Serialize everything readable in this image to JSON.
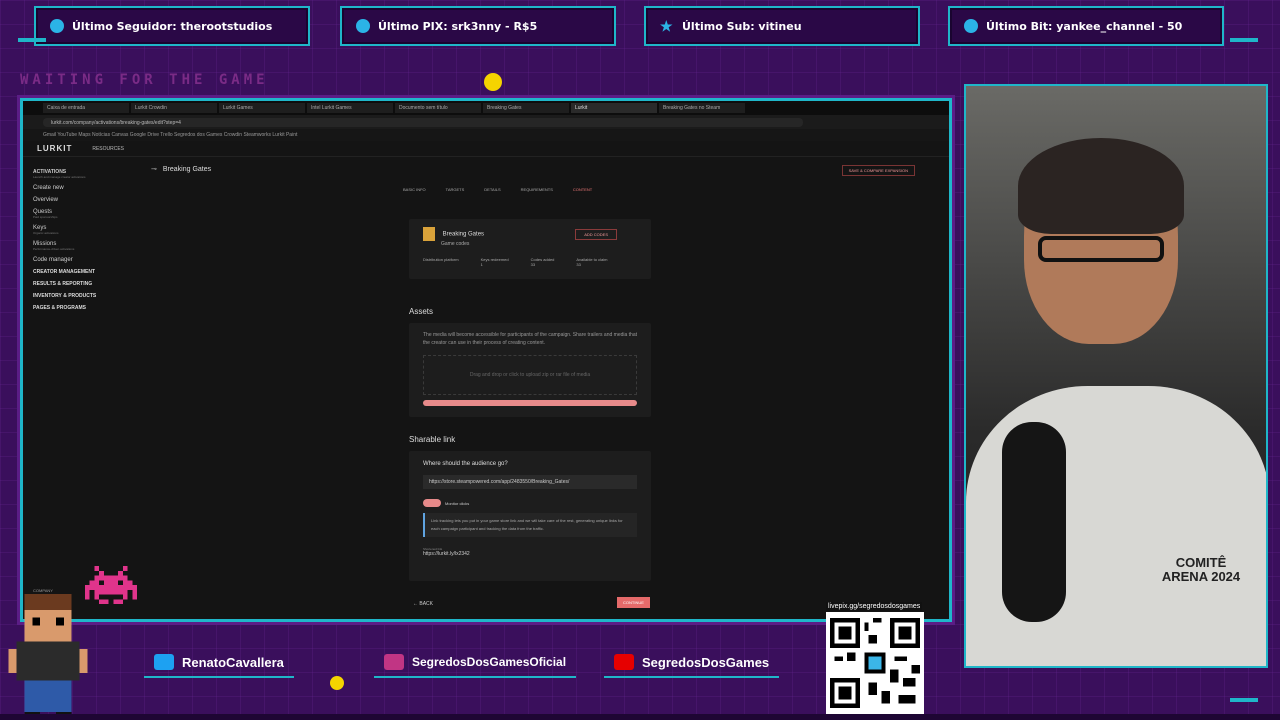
{
  "tickers": [
    {
      "label": "Último Seguidor: therootstudios",
      "icon": "person-icon"
    },
    {
      "label": "Último PIX: srk3nny - R$5",
      "icon": "dollar-icon"
    },
    {
      "label": "Último Sub: vitineu",
      "icon": "star-icon"
    },
    {
      "label": "Último Bit: yankee_channel - 50",
      "icon": "heart-icon"
    }
  ],
  "overlay_title": "WAITING FOR THE GAME",
  "browser": {
    "tabs": [
      "Caixa de entrada",
      "Lurkit Crowdin",
      "Lurkit Games",
      "Intel Lurkit Games",
      "Documento sem título",
      "Breaking Gates",
      "Lurkit",
      "Breaking Gates no Steam"
    ],
    "url": "lurkit.com/company/activations/breaking-gates/edit?step=4",
    "bookmarks": "Gmail  YouTube  Maps  Notícias  Canvas  Google Drive  Trello  Segredos dos Games  Crowdin  Steamworks  Lurkit  Paint"
  },
  "app": {
    "logo": "LURKIT",
    "resources": "RESOURCES",
    "sidebar": {
      "activations_label": "ACTIVATIONS",
      "activations_sub": "Launch and manage creator activations",
      "items": [
        {
          "label": "Create new"
        },
        {
          "label": "Overview"
        },
        {
          "label": "Quests",
          "sub": "Paid sponsorships"
        },
        {
          "label": "Keys",
          "sub": "Organic activations"
        },
        {
          "label": "Missions",
          "sub": "Performance-driven activations"
        },
        {
          "label": "Code manager"
        }
      ],
      "sections": [
        "CREATOR MANAGEMENT",
        "RESULTS & REPORTING",
        "INVENTORY & PRODUCTS",
        "PAGES & PROGRAMS"
      ],
      "company": "COMPANY"
    },
    "page_title": "Breaking Gates",
    "top_button": "SAVE & COMPARE EXPANSION",
    "steps": [
      "BASIC INFO",
      "TARGETS",
      "DETAILS",
      "REQUIREMENTS",
      "CONTENT"
    ],
    "game": {
      "name": "Breaking Gates",
      "sub": "Game codes",
      "add_button": "ADD CODES",
      "stats": [
        {
          "label": "Distribution platform",
          "value": ""
        },
        {
          "label": "Keys redeemed",
          "value": "1"
        },
        {
          "label": "Codes added",
          "value": "33"
        },
        {
          "label": "Available to claim",
          "value": "33"
        }
      ]
    },
    "assets": {
      "title": "Assets",
      "description": "The media will become accessible for participants of the campaign. Share trailers and media that the creator can use in their process of creating content.",
      "dropzone": "Drag and drop or click to upload zip or rar file of media"
    },
    "sharable": {
      "title": "Sharable link",
      "question": "Where should the audience go?",
      "url_value": "https://store.steampowered.com/app/2483550/Breaking_Gates/",
      "monitor_label": "Monitor clicks",
      "info": "Link tracking lets you put in your game store link and we will take care of the rest, generating unique links for each campaign participant and tracking the data from the traffic.",
      "short_label": "Shortened link",
      "short_url": "https://lurkit.ly/lx2342"
    },
    "back_label": "BACK",
    "continue_label": "CONTINUE"
  },
  "bottom": {
    "twitter": "RenatoCavallera",
    "instagram": "SegredosDosGamesOficial",
    "youtube": "SegredosDosGames",
    "livepix": "livepix.gg/segredosdosgames"
  },
  "webcam_text": "COMITÊ ARENA 2024",
  "colors": {
    "accent": "#1fb6c9",
    "background": "#3a0f5c",
    "brand_red": "#e56a6a"
  }
}
